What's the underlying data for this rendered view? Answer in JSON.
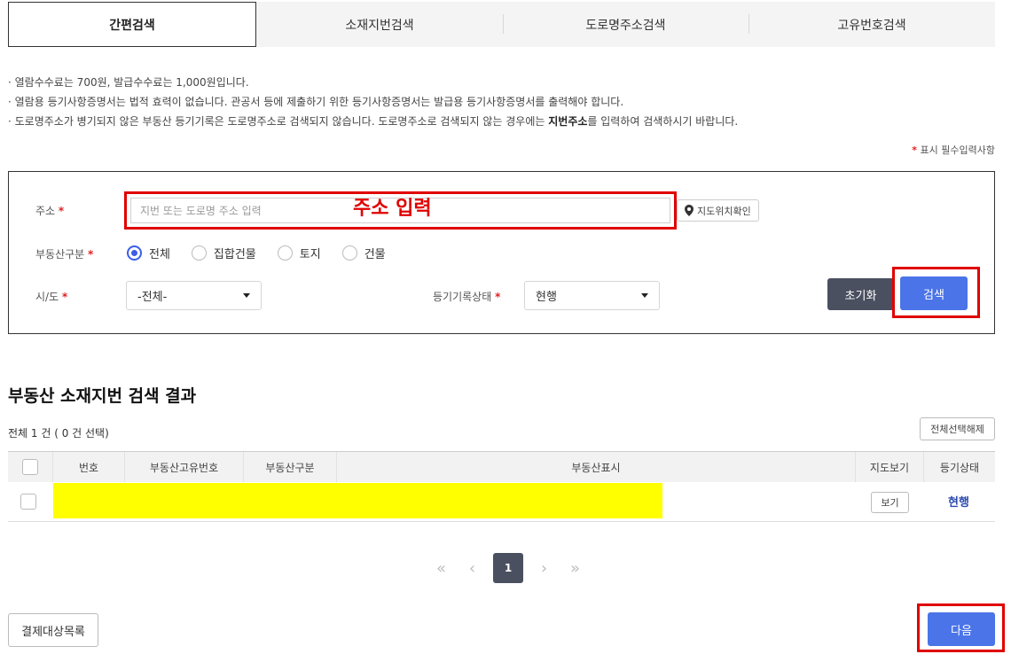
{
  "tabs": [
    {
      "label": "간편검색",
      "active": true
    },
    {
      "label": "소재지번검색",
      "active": false
    },
    {
      "label": "도로명주소검색",
      "active": false
    },
    {
      "label": "고유번호검색",
      "active": false
    }
  ],
  "notices": {
    "line1": "· 열람수수료는  700원, 발급수수료는  1,000원입니다.",
    "line2": "· 열람용 등기사항증명서는 법적 효력이 없습니다. 관공서 등에 제출하기 위한 등기사항증명서는 발급용 등기사항증명서를 출력해야 합니다.",
    "line3_a": "· 도로명주소가 병기되지 않은 부동산 등기기록은 도로명주소로 검색되지 않습니다. 도로명주소로 검색되지 않는 경우에는 ",
    "line3_bold": "지번주소",
    "line3_b": "를 입력하여 검색하시기 바랍니다."
  },
  "required_note": {
    "mark": "*",
    "text": "표시 필수입력사항"
  },
  "search_form": {
    "address_label": "주소",
    "required_mark": "*",
    "address_placeholder": "지번 또는 도로명 주소 입력",
    "address_annotation": "주소 입력",
    "map_check_label": "지도위치확인",
    "property_type_label": "부동산구분",
    "property_type_options": [
      "전체",
      "집합건물",
      "토지",
      "건물"
    ],
    "property_type_selected": "전체",
    "sido_label": "시/도",
    "sido_value": "-전체-",
    "record_status_label": "등기기록상태",
    "record_status_value": "현행",
    "reset_label": "초기화",
    "search_label": "검색"
  },
  "results": {
    "title": "부동산 소재지번 검색 결과",
    "count_text": "전체 1 건 ( 0 건 선택)",
    "deselect_all_label": "전체선택해제",
    "columns": [
      "번호",
      "부동산고유번호",
      "부동산구분",
      "부동산표시",
      "지도보기",
      "등기상태"
    ],
    "rows": [
      {
        "view_label": "보기",
        "status": "현행"
      }
    ]
  },
  "pagination": {
    "first": "«",
    "prev": "‹",
    "current": "1",
    "next": "›",
    "last": "»"
  },
  "footer": {
    "payment_list_label": "결제대상목록",
    "next_label": "다음"
  },
  "colors": {
    "accent": "#4a74e8",
    "dark_button": "#4a5060",
    "highlight_border": "#e00000",
    "redacted": "#ffff00",
    "status_text": "#2c4bb0"
  }
}
